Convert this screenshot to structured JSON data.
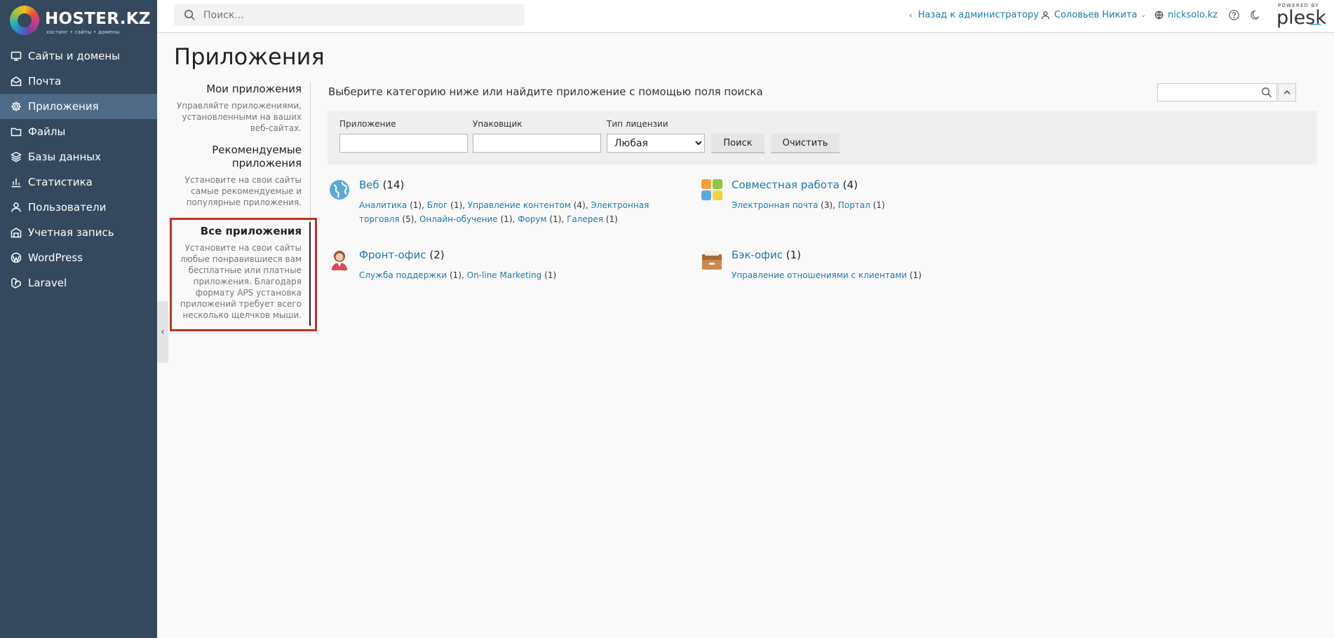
{
  "brand": {
    "name": "HOSTER.KZ",
    "name_main": "HOSTER",
    "name_suffix": ".KZ",
    "tagline": "хостинг • сайты • домены"
  },
  "sidebar": {
    "items": [
      {
        "label": "Сайты и домены",
        "icon": "monitor-icon"
      },
      {
        "label": "Почта",
        "icon": "mail-icon"
      },
      {
        "label": "Приложения",
        "icon": "gear-icon",
        "active": true
      },
      {
        "label": "Файлы",
        "icon": "folder-icon"
      },
      {
        "label": "Базы данных",
        "icon": "database-icon"
      },
      {
        "label": "Статистика",
        "icon": "bar-chart-icon"
      },
      {
        "label": "Пользователи",
        "icon": "user-icon"
      },
      {
        "label": "Учетная запись",
        "icon": "account-icon"
      },
      {
        "label": "WordPress",
        "icon": "wordpress-icon"
      },
      {
        "label": "Laravel",
        "icon": "laravel-icon"
      }
    ]
  },
  "topbar": {
    "search_placeholder": "Поиск...",
    "back_link": "Назад к администратору",
    "user_name": "Соловьев Никита",
    "domain": "nicksolo.kz",
    "powered_by": "POWERED BY",
    "plesk": "plesk"
  },
  "page": {
    "title": "Приложения"
  },
  "categories_nav": [
    {
      "title": "Мои приложения",
      "desc": "Управляйте приложениями, установленными на ваших веб-сайтах."
    },
    {
      "title": "Рекомендуемые приложения",
      "desc": "Установите на свои сайты самые рекомендуемые и популярные приложения."
    },
    {
      "title": "Все приложения",
      "desc": "Установите на свои сайты любые понравившиеся вам бесплатные или платные приложения. Благодаря формату APS установка приложений требует всего несколько щелчков мыши.",
      "selected": true
    }
  ],
  "main": {
    "intro": "Выберите категорию ниже или найдите приложение с помощью поля поиска",
    "filter": {
      "app_label": "Приложение",
      "packager_label": "Упаковщик",
      "license_label": "Тип лицензии",
      "license_value": "Любая",
      "search_button": "Поиск",
      "clear_button": "Очистить"
    },
    "app_categories": [
      {
        "name": "Веб",
        "count": "(14)",
        "icon": "globe-icon",
        "subs": [
          {
            "label": "Аналитика",
            "count": "(1)"
          },
          {
            "label": "Блог",
            "count": "(1)"
          },
          {
            "label": "Управление контентом",
            "count": "(4)"
          },
          {
            "label": "Электронная торговля",
            "count": "(5)"
          },
          {
            "label": "Онлайн-обучение",
            "count": "(1)"
          },
          {
            "label": "Форум",
            "count": "(1)"
          },
          {
            "label": "Галерея",
            "count": "(1)"
          }
        ]
      },
      {
        "name": "Совместная работа",
        "count": "(4)",
        "icon": "collaboration-icon",
        "subs": [
          {
            "label": "Электронная почта",
            "count": "(3)"
          },
          {
            "label": "Портал",
            "count": "(1)"
          }
        ]
      },
      {
        "name": "Фронт-офис",
        "count": "(2)",
        "icon": "front-office-icon",
        "subs": [
          {
            "label": "Служба поддержки",
            "count": "(1)"
          },
          {
            "label": "On-line Marketing",
            "count": "(1)"
          }
        ]
      },
      {
        "name": "Бэк-офис",
        "count": "(1)",
        "icon": "back-office-icon",
        "subs": [
          {
            "label": "Управление отношениями с клиентами",
            "count": "(1)"
          }
        ]
      }
    ]
  }
}
